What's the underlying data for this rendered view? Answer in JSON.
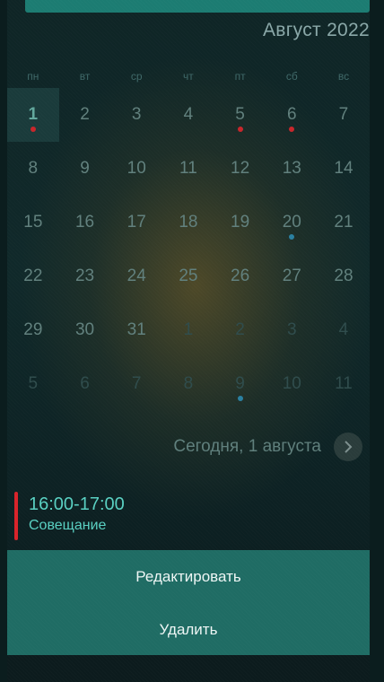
{
  "header": {
    "month_label": "Август 2022"
  },
  "weekdays": [
    "пн",
    "вт",
    "ср",
    "чт",
    "пт",
    "сб",
    "вс"
  ],
  "days": [
    {
      "label": "1",
      "state": "selected",
      "dot": "red"
    },
    {
      "label": "2"
    },
    {
      "label": "3"
    },
    {
      "label": "4"
    },
    {
      "label": "5",
      "dot": "red"
    },
    {
      "label": "6",
      "dot": "red"
    },
    {
      "label": "7"
    },
    {
      "label": "8"
    },
    {
      "label": "9"
    },
    {
      "label": "10"
    },
    {
      "label": "11"
    },
    {
      "label": "12"
    },
    {
      "label": "13"
    },
    {
      "label": "14"
    },
    {
      "label": "15"
    },
    {
      "label": "16"
    },
    {
      "label": "17"
    },
    {
      "label": "18"
    },
    {
      "label": "19"
    },
    {
      "label": "20",
      "dot": "blue"
    },
    {
      "label": "21"
    },
    {
      "label": "22"
    },
    {
      "label": "23"
    },
    {
      "label": "24"
    },
    {
      "label": "25"
    },
    {
      "label": "26"
    },
    {
      "label": "27"
    },
    {
      "label": "28"
    },
    {
      "label": "29"
    },
    {
      "label": "30"
    },
    {
      "label": "31"
    },
    {
      "label": "1",
      "state": "other"
    },
    {
      "label": "2",
      "state": "other"
    },
    {
      "label": "3",
      "state": "other"
    },
    {
      "label": "4",
      "state": "other"
    },
    {
      "label": "5",
      "state": "other"
    },
    {
      "label": "6",
      "state": "other"
    },
    {
      "label": "7",
      "state": "other"
    },
    {
      "label": "8",
      "state": "other"
    },
    {
      "label": "9",
      "state": "other",
      "dot": "blue"
    },
    {
      "label": "10",
      "state": "other"
    },
    {
      "label": "11",
      "state": "other"
    }
  ],
  "today": {
    "label": "Сегодня, 1 августа",
    "next_icon": "chevron-right-icon"
  },
  "event": {
    "time": "16:00-17:00",
    "title": "Совещание",
    "accent": "#d9232a"
  },
  "actions": {
    "edit": "Редактировать",
    "delete": "Удалить"
  },
  "colors": {
    "dot_red": "#c8262b",
    "dot_blue": "#2a80a1",
    "actions_bg": "#1f6c64",
    "event_text": "#59d0c2"
  }
}
